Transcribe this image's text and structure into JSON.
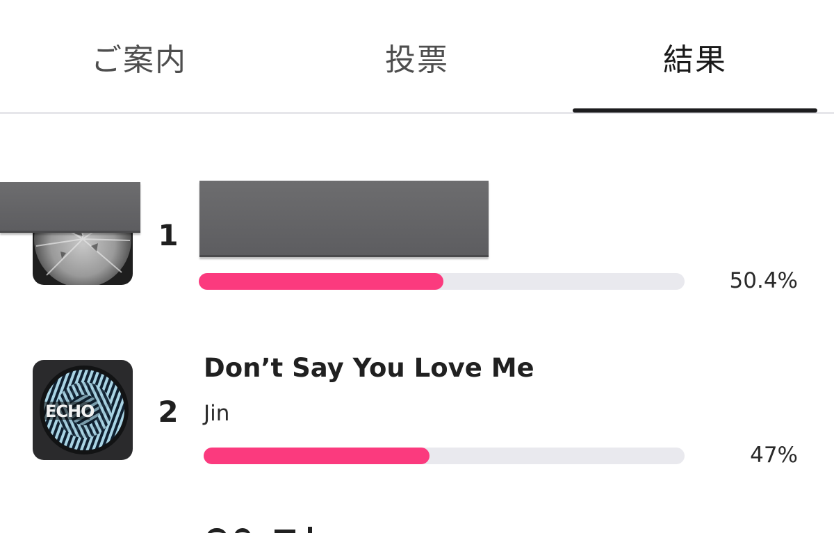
{
  "tabs": [
    {
      "label": "ご案内",
      "active": false
    },
    {
      "label": "投票",
      "active": false
    },
    {
      "label": "結果",
      "active": true
    }
  ],
  "results": [
    {
      "rank": "1",
      "title": "",
      "artist": "",
      "percent_label": "50.4%",
      "percent": 50.4,
      "bar_ratio": 0.503,
      "thumbnail_icon": "album-cover-icon",
      "title_redacted": true
    },
    {
      "rank": "2",
      "title": "Don’t Say You Love Me",
      "artist": "Jin",
      "percent_label": "47%",
      "percent": 47,
      "bar_ratio": 0.469,
      "thumbnail_icon": "album-cover-echo-icon",
      "album_text": "ECHO"
    }
  ],
  "colors": {
    "accent": "#fb3a7e",
    "track": "#e9e9ee",
    "redaction": "#626264",
    "active_tab_underline": "#1c1c1e"
  }
}
